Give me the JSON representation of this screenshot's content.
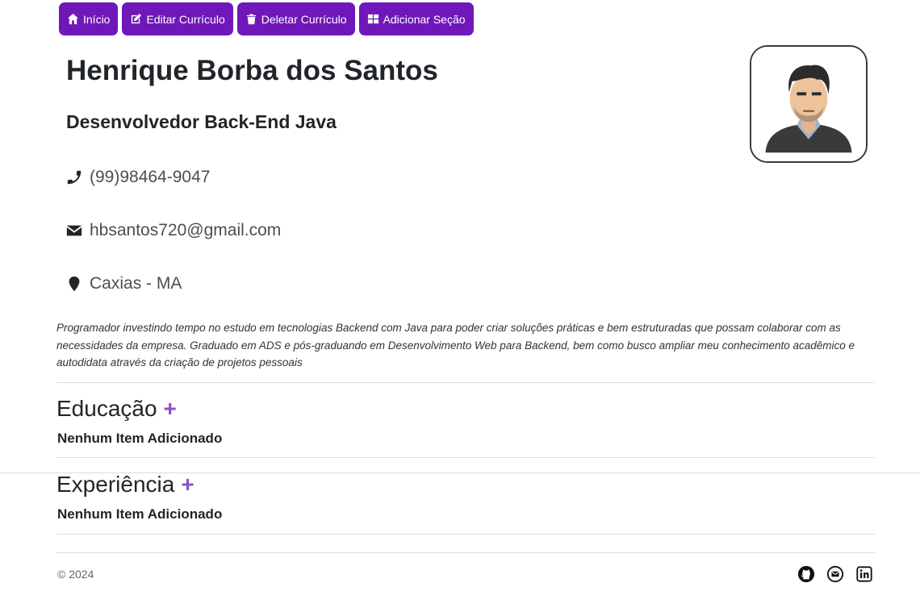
{
  "nav": {
    "home_label": "Início",
    "edit_label": "Editar Currículo",
    "delete_label": "Deletar Currículo",
    "add_section_label": "Adicionar Seção"
  },
  "profile": {
    "name": "Henrique Borba dos Santos",
    "role": "Desenvolvedor Back-End Java",
    "phone": "(99)98464-9047",
    "email": "hbsantos720@gmail.com",
    "location": "Caxias - MA",
    "summary": "Programador investindo tempo no estudo em tecnologias Backend com Java para poder criar soluções práticas e bem estruturadas que possam colaborar com as necessidades da empresa. Graduado em ADS e pós-graduando em Desenvolvimento Web para Backend, bem como busco ampliar meu conhecimento acadêmico e autodidata através da criação de projetos pessoais"
  },
  "sections": {
    "education": {
      "title": "Educação",
      "add_symbol": "+",
      "empty_text": "Nenhum Item Adicionado"
    },
    "experience": {
      "title": "Experiência",
      "add_symbol": "+",
      "empty_text": "Nenhum Item Adicionado"
    }
  },
  "footer": {
    "copyright": "© 2024",
    "icons": [
      "github-icon",
      "email-icon",
      "linkedin-icon"
    ]
  },
  "colors": {
    "accent": "#6f17b8",
    "plus": "#8b4fcf",
    "text": "#212529"
  }
}
